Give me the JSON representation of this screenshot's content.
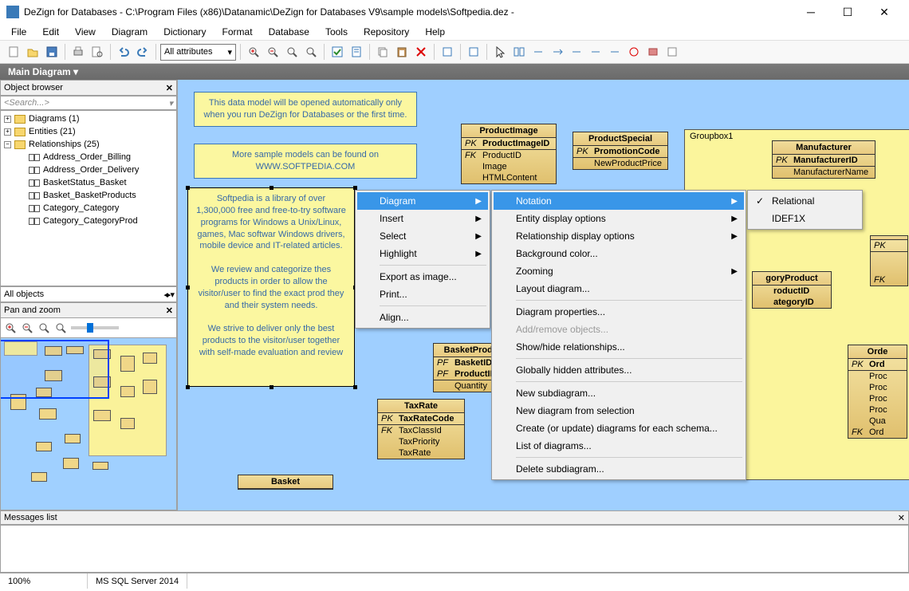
{
  "titlebar": {
    "title": "DeZign for Databases - C:\\Program Files (x86)\\Datanamic\\DeZign for Databases V9\\sample models\\Softpedia.dez -"
  },
  "menubar": [
    "File",
    "Edit",
    "View",
    "Diagram",
    "Dictionary",
    "Format",
    "Database",
    "Tools",
    "Repository",
    "Help"
  ],
  "toolbar": {
    "attr_dropdown": "All attributes"
  },
  "diagram_tab": "Main Diagram  ▾",
  "object_browser": {
    "title": "Object browser",
    "search": "<Search...>",
    "nodes": [
      {
        "lvl": 1,
        "exp": "+",
        "type": "folder",
        "label": "Diagrams (1)"
      },
      {
        "lvl": 1,
        "exp": "+",
        "type": "folder",
        "label": "Entities (21)"
      },
      {
        "lvl": 1,
        "exp": "−",
        "type": "folder",
        "label": "Relationships (25)"
      },
      {
        "lvl": 2,
        "type": "rel",
        "label": "Address_Order_Billing"
      },
      {
        "lvl": 2,
        "type": "rel",
        "label": "Address_Order_Delivery"
      },
      {
        "lvl": 2,
        "type": "rel",
        "label": "BasketStatus_Basket"
      },
      {
        "lvl": 2,
        "type": "rel",
        "label": "Basket_BasketProducts"
      },
      {
        "lvl": 2,
        "type": "rel",
        "label": "Category_Category"
      },
      {
        "lvl": 2,
        "type": "rel",
        "label": "Category_CategoryProd"
      }
    ],
    "all_objects": "All objects"
  },
  "pan_zoom": {
    "title": "Pan and zoom"
  },
  "notes": {
    "n1": "This data model will be opened automatically only when you run DeZign for Databases or the first time.",
    "n2a": "More sample models can be found on",
    "n2b": "WWW.SOFTPEDIA.COM",
    "n3a": "Softpedia is a library of over 1,300,000 free and free-to-try software programs for Windows a Unix/Linux, games, Mac softwar Windows drivers, mobile device and IT-related articles.",
    "n3b": "We review and categorize thes products in order to allow the visitor/user to find the exact prod they and their system needs.",
    "n3c": "We strive to deliver only the best products to the visitor/user together with self-made evaluation and review"
  },
  "groupbox": "Groupbox1",
  "entities": {
    "productimage": {
      "name": "ProductImage",
      "rows": [
        [
          "PK",
          "ProductImageID",
          1
        ],
        [
          "FK",
          "ProductID",
          0
        ],
        [
          "",
          "Image",
          0
        ],
        [
          "",
          "HTMLContent",
          0
        ]
      ]
    },
    "productspecial": {
      "name": "ProductSpecial",
      "rows": [
        [
          "PK",
          "PromotionCode",
          1
        ],
        [
          "",
          "NewProductPrice",
          0
        ]
      ]
    },
    "manufacturer": {
      "name": "Manufacturer",
      "rows": [
        [
          "PK",
          "ManufacturerID",
          1
        ],
        [
          "",
          "ManufacturerName",
          0
        ]
      ]
    },
    "basketproduct": {
      "name": "BasketProduct",
      "rows": [
        [
          "PF",
          "BasketID",
          1
        ],
        [
          "PF",
          "ProductID",
          1
        ],
        [
          "",
          "Quantity",
          0
        ]
      ]
    },
    "taxrate": {
      "name": "TaxRate",
      "rows": [
        [
          "PK",
          "TaxRateCode",
          1
        ],
        [
          "FK",
          "TaxClassId",
          0
        ],
        [
          "",
          "TaxPriority",
          0
        ],
        [
          "",
          "TaxRate",
          0
        ]
      ]
    },
    "categoryproduct": {
      "name": "goryProduct",
      "rows": [
        [
          "",
          "roductID",
          1
        ],
        [
          "",
          "ategoryID",
          1
        ]
      ]
    },
    "order": {
      "name": "Orde",
      "rows": [
        [
          "PK",
          "Ord",
          1
        ],
        [
          "",
          "Proc",
          0
        ],
        [
          "",
          "Proc",
          0
        ],
        [
          "",
          "Proc",
          0
        ],
        [
          "",
          "Proc",
          0
        ],
        [
          "",
          "Qua",
          0
        ],
        [
          "FK",
          "Ord",
          0
        ]
      ]
    },
    "partial_right": {
      "name": "",
      "rows": [
        [
          "PK",
          "",
          1
        ],
        [
          "",
          "",
          0
        ],
        [
          "",
          "",
          0
        ],
        [
          "FK",
          "",
          0
        ]
      ]
    }
  },
  "context_menus": {
    "m1": [
      {
        "label": "Diagram",
        "arrow": true,
        "hi": true
      },
      {
        "label": "Insert",
        "arrow": true
      },
      {
        "label": "Select",
        "arrow": true
      },
      {
        "label": "Highlight",
        "arrow": true
      },
      {
        "sep": true
      },
      {
        "label": "Export as image..."
      },
      {
        "label": "Print..."
      },
      {
        "sep": true
      },
      {
        "label": "Align..."
      }
    ],
    "m2": [
      {
        "label": "Notation",
        "arrow": true,
        "hi": true
      },
      {
        "label": "Entity display options",
        "arrow": true
      },
      {
        "label": "Relationship display options",
        "arrow": true
      },
      {
        "label": "Background color..."
      },
      {
        "label": "Zooming",
        "arrow": true
      },
      {
        "label": "Layout diagram..."
      },
      {
        "sep": true
      },
      {
        "label": "Diagram properties..."
      },
      {
        "label": "Add/remove objects...",
        "disabled": true
      },
      {
        "label": "Show/hide relationships..."
      },
      {
        "sep": true
      },
      {
        "label": "Globally hidden attributes..."
      },
      {
        "sep": true
      },
      {
        "label": "New subdiagram..."
      },
      {
        "label": "New diagram from selection"
      },
      {
        "label": "Create (or update) diagrams for each schema..."
      },
      {
        "label": "List of diagrams..."
      },
      {
        "sep": true
      },
      {
        "label": "Delete subdiagram..."
      }
    ],
    "m3": [
      {
        "label": "Relational",
        "chk": true
      },
      {
        "label": "IDEF1X"
      }
    ]
  },
  "messages": {
    "title": "Messages list"
  },
  "status": {
    "zoom": "100%",
    "db": "MS SQL Server 2014"
  }
}
